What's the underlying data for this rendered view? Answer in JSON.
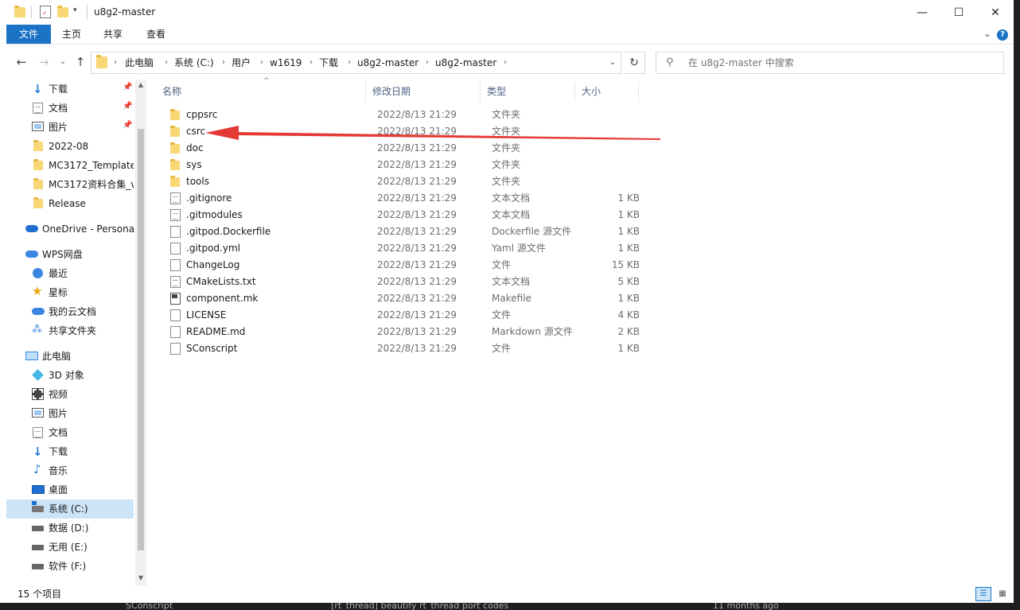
{
  "window": {
    "title": "u8g2-master",
    "controls": {
      "minimize": "—",
      "maximize": "☐",
      "close": "✕"
    }
  },
  "ribbon": {
    "tabs": [
      "文件",
      "主页",
      "共享",
      "查看"
    ],
    "help": "?"
  },
  "address": {
    "crumbs": [
      "此电脑",
      "系统 (C:)",
      "用户",
      "w1619",
      "下载",
      "u8g2-master",
      "u8g2-master"
    ]
  },
  "search": {
    "placeholder": "在 u8g2-master 中搜索"
  },
  "nav": {
    "quick_access": [
      {
        "label": "下载",
        "icon": "download-icon",
        "pinned": true
      },
      {
        "label": "文档",
        "icon": "document-icon",
        "pinned": true
      },
      {
        "label": "图片",
        "icon": "picture-icon",
        "pinned": true
      },
      {
        "label": "2022-08",
        "icon": "folder-icon",
        "pinned": false
      },
      {
        "label": "MC3172_Template",
        "icon": "folder-icon",
        "pinned": false
      },
      {
        "label": "MC3172资料合集_v",
        "icon": "folder-icon",
        "pinned": false
      },
      {
        "label": "Release",
        "icon": "folder-icon",
        "pinned": false
      }
    ],
    "onedrive": "OneDrive - Persona",
    "wps": {
      "label": "WPS网盘",
      "items": [
        "最近",
        "星标",
        "我的云文档",
        "共享文件夹"
      ]
    },
    "this_pc": {
      "label": "此电脑",
      "items": [
        "3D 对象",
        "视频",
        "图片",
        "文档",
        "下载",
        "音乐",
        "桌面",
        "系统 (C:)",
        "数据 (D:)",
        "无用 (E:)",
        "软件 (F:)"
      ],
      "selected": "系统 (C:)"
    }
  },
  "columns": {
    "name": "名称",
    "date": "修改日期",
    "type": "类型",
    "size": "大小"
  },
  "files": [
    {
      "name": "cppsrc",
      "date": "2022/8/13 21:29",
      "type": "文件夹",
      "size": "",
      "kind": "folder"
    },
    {
      "name": "csrc",
      "date": "2022/8/13 21:29",
      "type": "文件夹",
      "size": "",
      "kind": "folder"
    },
    {
      "name": "doc",
      "date": "2022/8/13 21:29",
      "type": "文件夹",
      "size": "",
      "kind": "folder"
    },
    {
      "name": "sys",
      "date": "2022/8/13 21:29",
      "type": "文件夹",
      "size": "",
      "kind": "folder"
    },
    {
      "name": "tools",
      "date": "2022/8/13 21:29",
      "type": "文件夹",
      "size": "",
      "kind": "folder"
    },
    {
      "name": ".gitignore",
      "date": "2022/8/13 21:29",
      "type": "文本文档",
      "size": "1 KB",
      "kind": "text"
    },
    {
      "name": ".gitmodules",
      "date": "2022/8/13 21:29",
      "type": "文本文档",
      "size": "1 KB",
      "kind": "text"
    },
    {
      "name": ".gitpod.Dockerfile",
      "date": "2022/8/13 21:29",
      "type": "Dockerfile 源文件",
      "size": "1 KB",
      "kind": "plain"
    },
    {
      "name": ".gitpod.yml",
      "date": "2022/8/13 21:29",
      "type": "Yaml 源文件",
      "size": "1 KB",
      "kind": "plain"
    },
    {
      "name": "ChangeLog",
      "date": "2022/8/13 21:29",
      "type": "文件",
      "size": "15 KB",
      "kind": "plain"
    },
    {
      "name": "CMakeLists.txt",
      "date": "2022/8/13 21:29",
      "type": "文本文档",
      "size": "5 KB",
      "kind": "text"
    },
    {
      "name": "component.mk",
      "date": "2022/8/13 21:29",
      "type": "Makefile",
      "size": "1 KB",
      "kind": "make"
    },
    {
      "name": "LICENSE",
      "date": "2022/8/13 21:29",
      "type": "文件",
      "size": "4 KB",
      "kind": "plain"
    },
    {
      "name": "README.md",
      "date": "2022/8/13 21:29",
      "type": "Markdown 源文件",
      "size": "2 KB",
      "kind": "plain"
    },
    {
      "name": "SConscript",
      "date": "2022/8/13 21:29",
      "type": "文件",
      "size": "1 KB",
      "kind": "plain"
    }
  ],
  "status": {
    "count": "15 个项目"
  },
  "background_app": {
    "bottom_texts": [
      "SConscript",
      "[rt_thread] beautify rt_thread port codes",
      "11 months ago"
    ]
  },
  "colors": {
    "accent": "#1a73c5",
    "selected": "#cce4f7",
    "folder": "#f8d775",
    "annotation_arrow": "#e53935"
  }
}
